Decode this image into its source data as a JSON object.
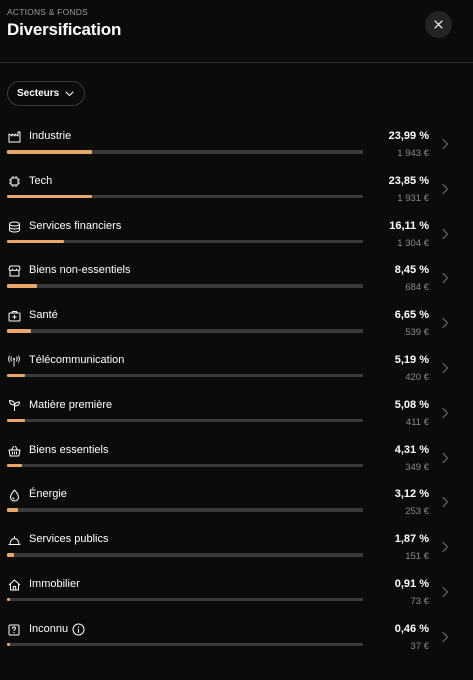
{
  "header": {
    "overline": "ACTIONS & FONDS",
    "title": "Diversification",
    "close_icon": "close-icon"
  },
  "filter": {
    "label": "Secteurs",
    "icon": "chevron-down-icon"
  },
  "colors": {
    "accent": "#e8a767",
    "track": "#3a3a3a",
    "background": "#0b0b0b",
    "muted_text": "#8a8a8a"
  },
  "sectors": [
    {
      "label": "Industrie",
      "percent": "23,99 %",
      "amount": "1 943 €",
      "share": 23.99,
      "icon": "factory-icon"
    },
    {
      "label": "Tech",
      "percent": "23,85 %",
      "amount": "1 931 €",
      "share": 23.85,
      "icon": "chip-icon"
    },
    {
      "label": "Services financiers",
      "percent": "16,11 %",
      "amount": "1 304 €",
      "share": 16.11,
      "icon": "coins-icon"
    },
    {
      "label": "Biens non-essentiels",
      "percent": "8,45 %",
      "amount": "684 €",
      "share": 8.45,
      "icon": "store-icon"
    },
    {
      "label": "Santé",
      "percent": "6,65 %",
      "amount": "539 €",
      "share": 6.65,
      "icon": "medical-kit-icon"
    },
    {
      "label": "Télécommunication",
      "percent": "5,19 %",
      "amount": "420 €",
      "share": 5.19,
      "icon": "antenna-icon"
    },
    {
      "label": "Matière première",
      "percent": "5,08 %",
      "amount": "411 €",
      "share": 5.08,
      "icon": "sprout-icon"
    },
    {
      "label": "Biens essentiels",
      "percent": "4,31 %",
      "amount": "349 €",
      "share": 4.31,
      "icon": "basket-icon"
    },
    {
      "label": "Énergie",
      "percent": "3,12 %",
      "amount": "253 €",
      "share": 3.12,
      "icon": "drop-icon"
    },
    {
      "label": "Services publics",
      "percent": "1,87 %",
      "amount": "151 €",
      "share": 1.87,
      "icon": "bell-icon"
    },
    {
      "label": "Immobilier",
      "percent": "0,91 %",
      "amount": "73 €",
      "share": 0.91,
      "icon": "house-icon"
    },
    {
      "label": "Inconnu",
      "percent": "0,46 %",
      "amount": "37 €",
      "share": 0.46,
      "icon": "question-icon",
      "info_icon": "info-icon"
    }
  ]
}
